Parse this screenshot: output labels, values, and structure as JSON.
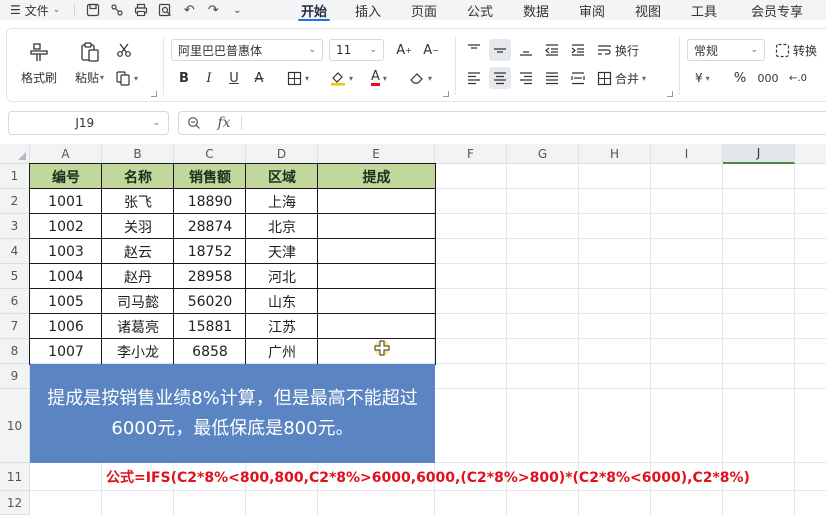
{
  "menubar": {
    "file_label": "文件",
    "tabs": [
      {
        "label": "开始",
        "active": true
      },
      {
        "label": "插入",
        "active": false
      },
      {
        "label": "页面",
        "active": false
      },
      {
        "label": "公式",
        "active": false
      },
      {
        "label": "数据",
        "active": false
      },
      {
        "label": "审阅",
        "active": false
      },
      {
        "label": "视图",
        "active": false
      },
      {
        "label": "工具",
        "active": false
      },
      {
        "label": "会员专享",
        "active": false
      }
    ]
  },
  "ribbon": {
    "format_painter": "格式刷",
    "paste": "粘贴",
    "font_name": "阿里巴巴普惠体",
    "font_size": "11",
    "wrap": "换行",
    "merge": "合并",
    "number_format": "常规",
    "convert": "转换"
  },
  "formula_bar": {
    "name_box": "J19",
    "fx_symbol": "fx",
    "formula": ""
  },
  "columns": [
    "A",
    "B",
    "C",
    "D",
    "E",
    "F",
    "G",
    "H",
    "I",
    "J"
  ],
  "selected_column": "J",
  "rows": [
    "1",
    "2",
    "3",
    "4",
    "5",
    "6",
    "7",
    "8",
    "9",
    "10",
    "11",
    "12"
  ],
  "table": {
    "headers": [
      "编号",
      "名称",
      "销售额",
      "区域",
      "提成"
    ],
    "rows": [
      [
        "1001",
        "张飞",
        "18890",
        "上海",
        ""
      ],
      [
        "1002",
        "关羽",
        "28874",
        "北京",
        ""
      ],
      [
        "1003",
        "赵云",
        "18752",
        "天津",
        ""
      ],
      [
        "1004",
        "赵丹",
        "28958",
        "河北",
        ""
      ],
      [
        "1005",
        "司马懿",
        "56020",
        "山东",
        ""
      ],
      [
        "1006",
        "诸葛亮",
        "15881",
        "江苏",
        ""
      ],
      [
        "1007",
        "李小龙",
        "6858",
        "广州",
        ""
      ]
    ]
  },
  "note": "提成是按销售业绩8%计算，但是最高不能超过6000元，最低保底是800元。",
  "formula_text": "公式=IFS(C2*8%<800,800,C2*8%>6000,6000,(C2*8%>800)*(C2*8%<6000),C2*8%)",
  "colors": {
    "header_fill": "#c3d69b",
    "note_fill": "#5a85c2",
    "formula_text": "#e0101c",
    "accent": "#1f6fe5"
  }
}
